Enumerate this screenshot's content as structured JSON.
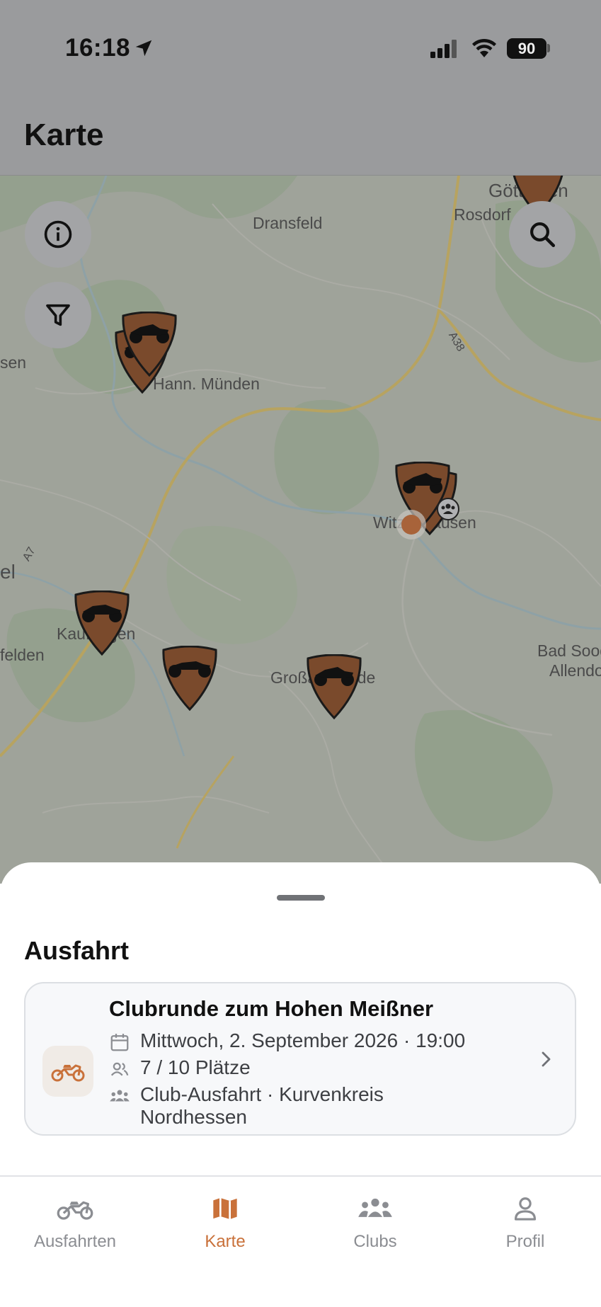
{
  "status_bar": {
    "time": "16:18",
    "battery": "90"
  },
  "header": {
    "title": "Karte"
  },
  "map": {
    "places": {
      "goettingen": "Göttingen",
      "rosdorf": "Rosdorf",
      "dransfeld": "Dransfeld",
      "sen": "sen",
      "hann_muenden": "Hann. Münden",
      "witzenhausen": "Witzenhausen",
      "el": "el",
      "kaufungen": "Kaufungen",
      "felden": "felden",
      "grossalmerode": "Großalmerode",
      "bad_sooden": "Bad Sooden-",
      "allendorf": "Allendorf"
    },
    "roads": {
      "a38": "A38",
      "a7": "A7"
    }
  },
  "sheet": {
    "title": "Ausfahrt",
    "card": {
      "title": "Clubrunde zum Hohen Meißner",
      "date": "Mittwoch, 2. September 2026 · 19:00",
      "seats": "7 / 10 Plätze",
      "type_line1": "Club-Ausfahrt · Kurvenkreis",
      "type_line2": "Nordhessen"
    }
  },
  "tabbar": {
    "tabs": [
      {
        "label": "Ausfahrten",
        "icon": "motorcycle-icon",
        "active": false
      },
      {
        "label": "Karte",
        "icon": "map-icon",
        "active": true
      },
      {
        "label": "Clubs",
        "icon": "people-icon",
        "active": false
      },
      {
        "label": "Profil",
        "icon": "person-icon",
        "active": false
      }
    ]
  },
  "colors": {
    "accent": "#c9713a",
    "pin": "#7a4a2c",
    "overlay": "#9a9b9d"
  }
}
